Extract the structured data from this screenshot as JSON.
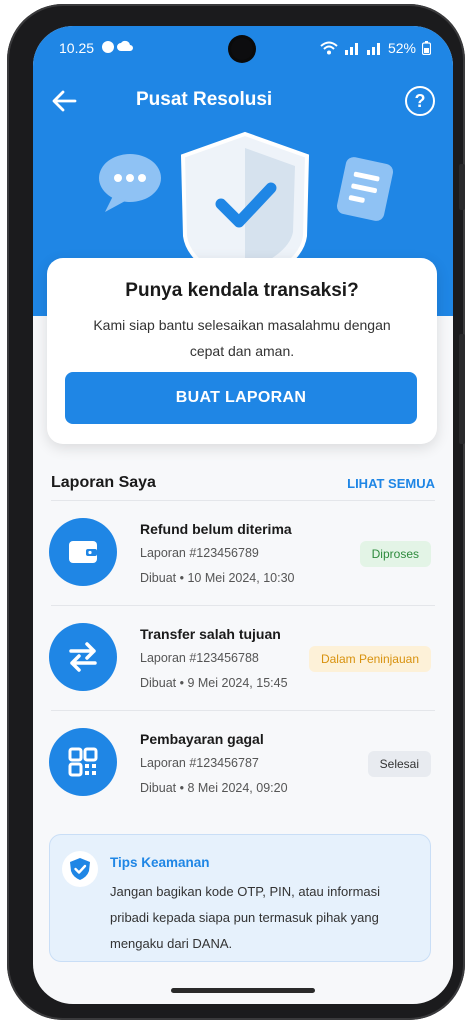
{
  "status_bar": {
    "time": "10.25",
    "battery": "52%"
  },
  "nav": {
    "title": "Pusat Resolusi",
    "help_label": "?"
  },
  "hero": {
    "question": "Punya kendala transaksi?",
    "subtitle": "Kami siap bantu selesaikan masalahmu dengan cepat dan aman.",
    "button_label": "BUAT LAPORAN"
  },
  "reports": {
    "title": "Laporan Saya",
    "see_all": "LIHAT SEMUA",
    "items": [
      {
        "icon": "wallet-icon",
        "name": "Refund belum diterima",
        "number": "Laporan #123456789",
        "date": "Dibuat • 10 Mei 2024, 10:30",
        "status": "Diproses",
        "status_color": "#2e8b3d"
      },
      {
        "icon": "transfer-icon",
        "name": "Transfer salah tujuan",
        "number": "Laporan #123456788",
        "date": "Dibuat • 9 Mei 2024, 15:45",
        "status": "Dalam Peninjauan",
        "status_color": "#d8920f"
      },
      {
        "icon": "qr-code-icon",
        "name": "Pembayaran gagal",
        "number": "Laporan #123456787",
        "date": "Dibuat • 8 Mei 2024, 09:20",
        "status": "Selesai",
        "status_color": "#333333"
      }
    ]
  },
  "tips": {
    "title": "Tips Keamanan",
    "text": "Jangan bagikan kode OTP, PIN, atau informasi pribadi kepada siapa pun termasuk pihak yang mengaku dari DANA."
  },
  "colors": {
    "primary": "#1f86e5",
    "background": "#f7f8fa"
  }
}
